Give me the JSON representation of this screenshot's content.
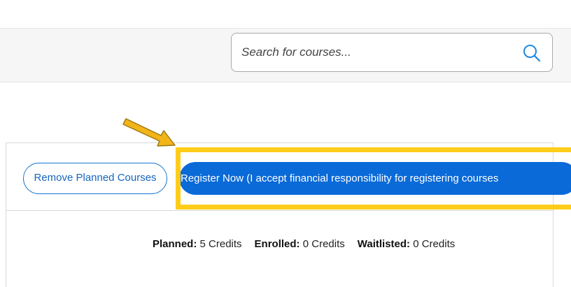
{
  "search": {
    "placeholder": "Search for courses..."
  },
  "actions": {
    "remove_label": "Remove Planned Courses",
    "register_label": "Register Now (I accept financial responsibility for registering courses"
  },
  "credits": {
    "planned_label": "Planned:",
    "planned_value": "5 Credits",
    "enrolled_label": "Enrolled:",
    "enrolled_value": "0 Credits",
    "waitlisted_label": "Waitlisted:",
    "waitlisted_value": "0 Credits"
  },
  "annotation": {
    "highlight_color": "#ffcc1a",
    "arrow_color": "#f2b418"
  },
  "colors": {
    "primary": "#0a6ad8",
    "outline_button": "#1976d2"
  }
}
